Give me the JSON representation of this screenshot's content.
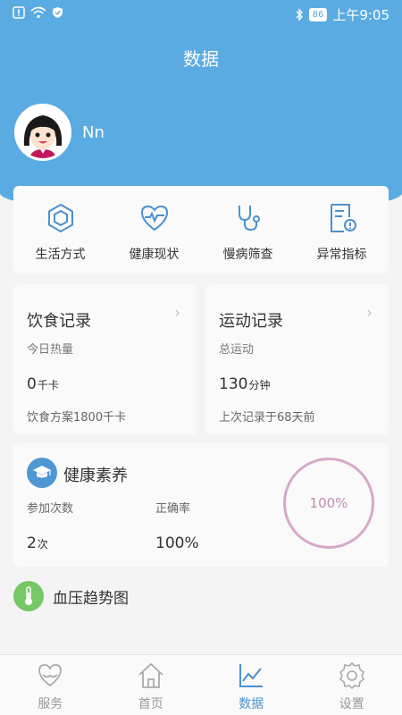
{
  "status_bar": {
    "battery": "86",
    "time": "上午9:05",
    "icons": [
      "alert-icon",
      "wifi-icon",
      "shield-icon",
      "bluetooth-icon"
    ]
  },
  "header": {
    "title": "数据"
  },
  "profile": {
    "username": "Nn"
  },
  "quick_actions": [
    {
      "label": "生活方式",
      "icon": "hexagon-icon"
    },
    {
      "label": "健康现状",
      "icon": "heart-pulse-icon"
    },
    {
      "label": "慢病筛查",
      "icon": "stethoscope-icon"
    },
    {
      "label": "异常指标",
      "icon": "document-alert-icon"
    }
  ],
  "diet": {
    "title": "饮食记录",
    "arrow": "›",
    "subtitle": "今日热量",
    "value": "0",
    "unit": "千卡",
    "note": "饮食方案1800千卡"
  },
  "exercise": {
    "title": "运动记录",
    "arrow": "›",
    "subtitle": "总运动",
    "value": "130",
    "unit": "分钟",
    "note": "上次记录于68天前"
  },
  "literacy": {
    "title": "健康素养",
    "icon": "graduation-cap-icon",
    "count_label": "参加次数",
    "count_value": "2",
    "count_unit": "次",
    "accuracy_label": "正确率",
    "accuracy_value": "100%",
    "ring_text": "100%",
    "ring_fraction": 1.0
  },
  "blood_pressure": {
    "title": "血压趋势图",
    "icon": "thermometer-icon"
  },
  "tabs": [
    {
      "label": "服务",
      "icon": "heart-hands-icon",
      "active": false
    },
    {
      "label": "首页",
      "icon": "home-icon",
      "active": false
    },
    {
      "label": "数据",
      "icon": "chart-icon",
      "active": true
    },
    {
      "label": "设置",
      "icon": "gear-icon",
      "active": false
    }
  ],
  "colors": {
    "primary": "#5aabe2",
    "active_tab": "#4a90cf",
    "ring": "#d8a8c8",
    "literacy_icon": "#4e97d4",
    "bp_icon": "#76c766"
  }
}
